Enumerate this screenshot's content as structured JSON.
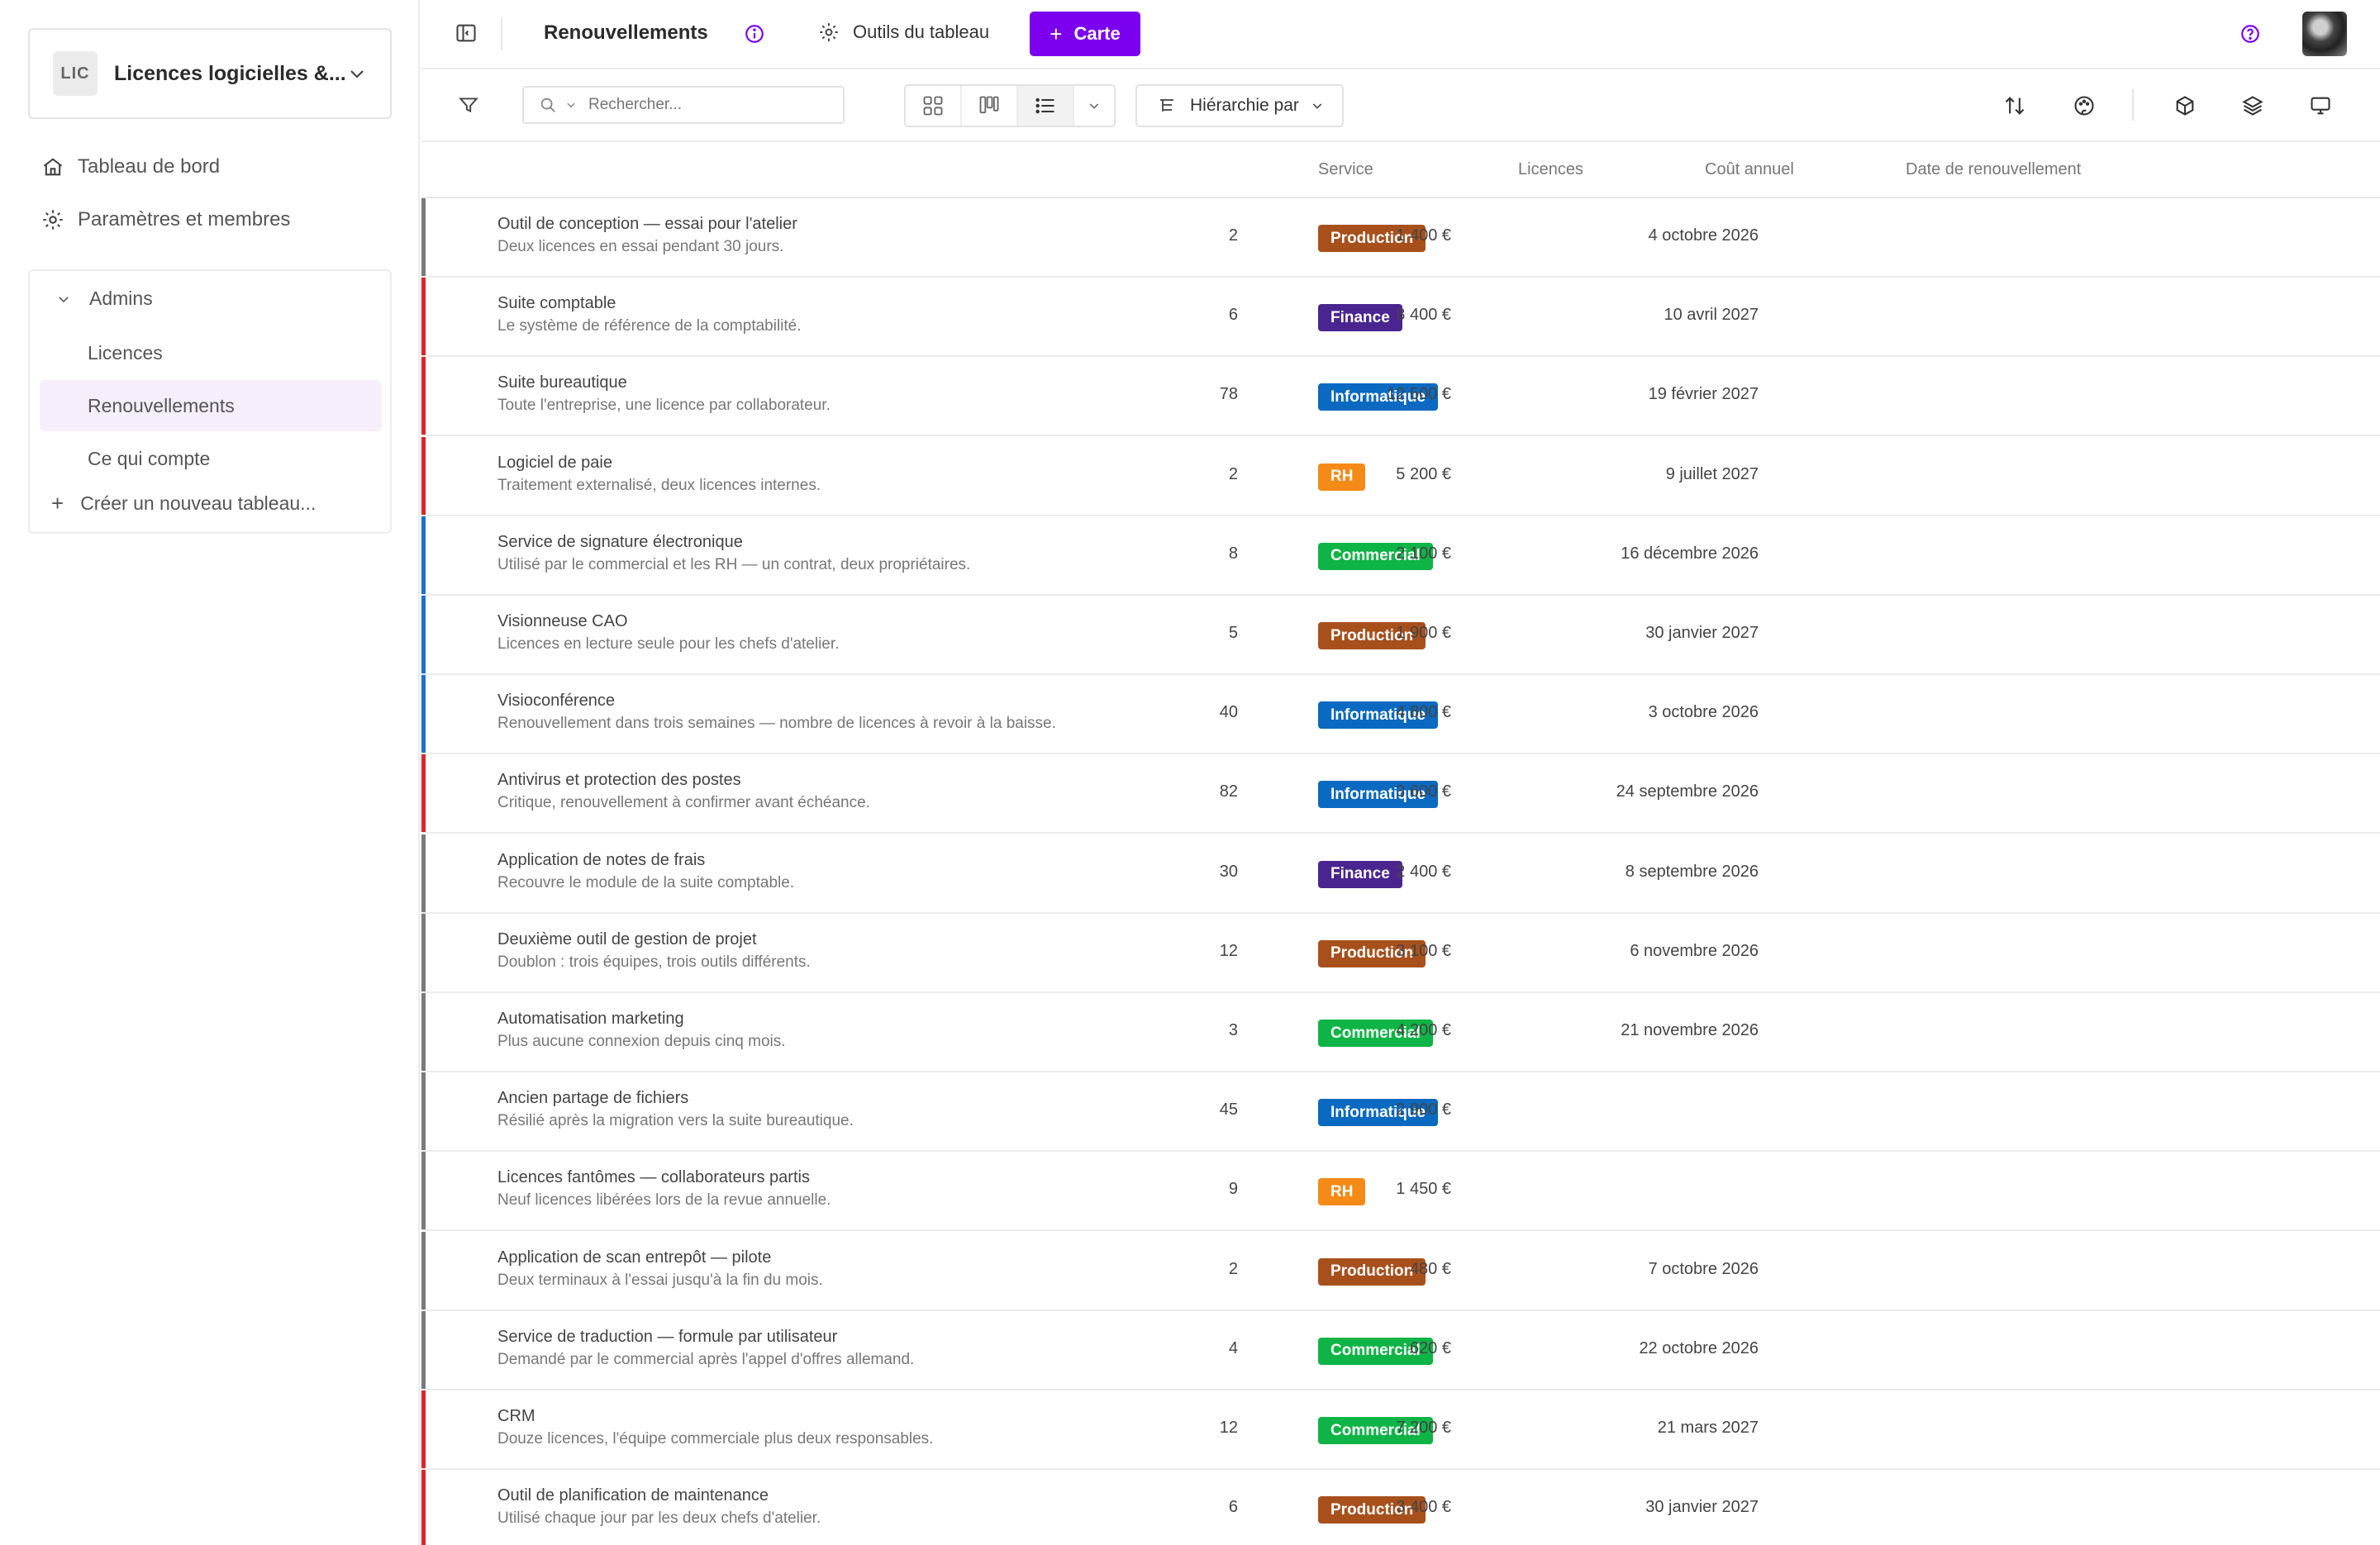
{
  "colors": {
    "accent": "#7b00f0",
    "bar_gray": "#7a7a7a",
    "bar_red": "#e0242b",
    "bar_blue": "#1f6fd1",
    "tag_production": "#a8501c",
    "tag_finance": "#4a2590",
    "tag_informatique": "#0a69c0",
    "tag_rh": "#f58a16",
    "tag_commercial": "#0eb446"
  },
  "workspace": {
    "badge": "LIC",
    "name": "Licences logicielles &..."
  },
  "nav": {
    "dashboard": "Tableau de bord",
    "settings": "Paramètres et membres"
  },
  "boards": {
    "group": "Admins",
    "items": [
      "Licences",
      "Renouvellements",
      "Ce qui compte"
    ],
    "create": "Créer un nouveau tableau..."
  },
  "topbar": {
    "title": "Renouvellements",
    "tools": "Outils du tableau",
    "card_button": "Carte"
  },
  "toolbar": {
    "search_placeholder": "Rechercher...",
    "hierarchy": "Hiérarchie par"
  },
  "columns": {
    "service": "Service",
    "licences": "Licences",
    "cost": "Coût annuel",
    "renewal": "Date de renouvellement"
  },
  "rows": [
    {
      "name": "Outil de conception — essai pour l'atelier",
      "desc": "Deux licences en essai pendant 30 jours.",
      "service": "Production",
      "tag_color": "#a8501c",
      "bar_color": "#7a7a7a",
      "licences": "2",
      "cost": "1 400 €",
      "date": "4 octobre 2026"
    },
    {
      "name": "Suite comptable",
      "desc": "Le système de référence de la comptabilité.",
      "service": "Finance",
      "tag_color": "#4a2590",
      "bar_color": "#e0242b",
      "licences": "6",
      "cost": "8 400 €",
      "date": "10 avril 2027"
    },
    {
      "name": "Suite bureautique",
      "desc": "Toute l'entreprise, une licence par collaborateur.",
      "service": "Informatique",
      "tag_color": "#0a69c0",
      "bar_color": "#e0242b",
      "licences": "78",
      "cost": "12 500 €",
      "date": "19 février 2027"
    },
    {
      "name": "Logiciel de paie",
      "desc": "Traitement externalisé, deux licences internes.",
      "service": "RH",
      "tag_color": "#f58a16",
      "bar_color": "#e0242b",
      "licences": "2",
      "cost": "5 200 €",
      "date": "9 juillet 2027"
    },
    {
      "name": "Service de signature électronique",
      "desc": "Utilisé par le commercial et les RH — un contrat, deux propriétaires.",
      "service": "Commercial",
      "tag_color": "#0eb446",
      "bar_color": "#1f6fd1",
      "licences": "8",
      "cost": "2 100 €",
      "date": "16 décembre 2026"
    },
    {
      "name": "Visionneuse CAO",
      "desc": "Licences en lecture seule pour les chefs d'atelier.",
      "service": "Production",
      "tag_color": "#a8501c",
      "bar_color": "#1f6fd1",
      "licences": "5",
      "cost": "1 900 €",
      "date": "30 janvier 2027"
    },
    {
      "name": "Visioconférence",
      "desc": "Renouvellement dans trois semaines — nombre de licences à revoir à la baisse.",
      "service": "Informatique",
      "tag_color": "#0a69c0",
      "bar_color": "#1f6fd1",
      "licences": "40",
      "cost": "4 800 €",
      "date": "3 octobre 2026"
    },
    {
      "name": "Antivirus et protection des postes",
      "desc": "Critique, renouvellement à confirmer avant échéance.",
      "service": "Informatique",
      "tag_color": "#0a69c0",
      "bar_color": "#e0242b",
      "licences": "82",
      "cost": "3 600 €",
      "date": "24 septembre 2026"
    },
    {
      "name": "Application de notes de frais",
      "desc": "Recouvre le module de la suite comptable.",
      "service": "Finance",
      "tag_color": "#4a2590",
      "bar_color": "#7a7a7a",
      "licences": "30",
      "cost": "2 400 €",
      "date": "8 septembre 2026"
    },
    {
      "name": "Deuxième outil de gestion de projet",
      "desc": "Doublon : trois équipes, trois outils différents.",
      "service": "Production",
      "tag_color": "#a8501c",
      "bar_color": "#7a7a7a",
      "licences": "12",
      "cost": "3 100 €",
      "date": "6 novembre 2026"
    },
    {
      "name": "Automatisation marketing",
      "desc": "Plus aucune connexion depuis cinq mois.",
      "service": "Commercial",
      "tag_color": "#0eb446",
      "bar_color": "#7a7a7a",
      "licences": "3",
      "cost": "4 200 €",
      "date": "21 novembre 2026"
    },
    {
      "name": "Ancien partage de fichiers",
      "desc": "Résilié après la migration vers la suite bureautique.",
      "service": "Informatique",
      "tag_color": "#0a69c0",
      "bar_color": "#7a7a7a",
      "licences": "45",
      "cost": "2 900 €",
      "date": ""
    },
    {
      "name": "Licences fantômes — collaborateurs partis",
      "desc": "Neuf licences libérées lors de la revue annuelle.",
      "service": "RH",
      "tag_color": "#f58a16",
      "bar_color": "#7a7a7a",
      "licences": "9",
      "cost": "1 450 €",
      "date": ""
    },
    {
      "name": "Application de scan entrepôt — pilote",
      "desc": "Deux terminaux à l'essai jusqu'à la fin du mois.",
      "service": "Production",
      "tag_color": "#a8501c",
      "bar_color": "#7a7a7a",
      "licences": "2",
      "cost": "480 €",
      "date": "7 octobre 2026"
    },
    {
      "name": "Service de traduction — formule par utilisateur",
      "desc": "Demandé par le commercial après l'appel d'offres allemand.",
      "service": "Commercial",
      "tag_color": "#0eb446",
      "bar_color": "#7a7a7a",
      "licences": "4",
      "cost": "620 €",
      "date": "22 octobre 2026"
    },
    {
      "name": "CRM",
      "desc": "Douze licences, l'équipe commerciale plus deux responsables.",
      "service": "Commercial",
      "tag_color": "#0eb446",
      "bar_color": "#e0242b",
      "licences": "12",
      "cost": "7 200 €",
      "date": "21 mars 2027"
    },
    {
      "name": "Outil de planification de maintenance",
      "desc": "Utilisé chaque jour par les deux chefs d'atelier.",
      "service": "Production",
      "tag_color": "#a8501c",
      "bar_color": "#e0242b",
      "licences": "6",
      "cost": "3 400 €",
      "date": "30 janvier 2027"
    }
  ]
}
